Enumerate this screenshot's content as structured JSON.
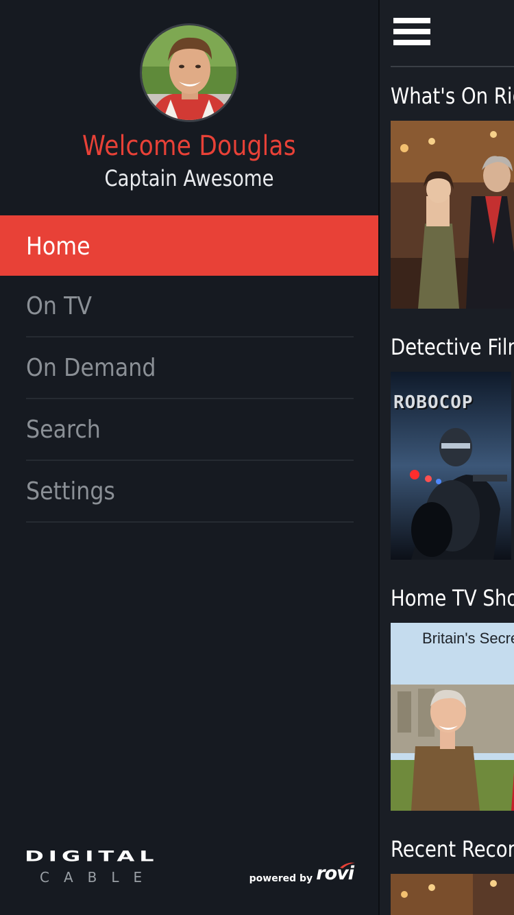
{
  "profile": {
    "welcome": "Welcome Douglas",
    "subtitle": "Captain Awesome"
  },
  "menu": {
    "items": [
      {
        "label": "Home",
        "active": true
      },
      {
        "label": "On TV",
        "active": false
      },
      {
        "label": "On Demand",
        "active": false
      },
      {
        "label": "Search",
        "active": false
      },
      {
        "label": "Settings",
        "active": false
      }
    ]
  },
  "branding": {
    "logo_top": "DIGITAL",
    "logo_bottom": "CABLE",
    "powered_by": "powered by",
    "provider": "rovi"
  },
  "main": {
    "sections": [
      {
        "title": "What's On Right Now"
      },
      {
        "title": "Detective Films"
      },
      {
        "title": "Home TV Shows"
      },
      {
        "title": "Recent Recordings"
      }
    ],
    "posters": {
      "robocop_title": "ROBOCOP",
      "britain_text": "Britain's Secret"
    }
  },
  "colors": {
    "accent": "#e84137",
    "background": "#161a21",
    "menu_text": "#8b9096",
    "divider": "#262b32"
  },
  "icons": {
    "menu": "hamburger-icon"
  }
}
